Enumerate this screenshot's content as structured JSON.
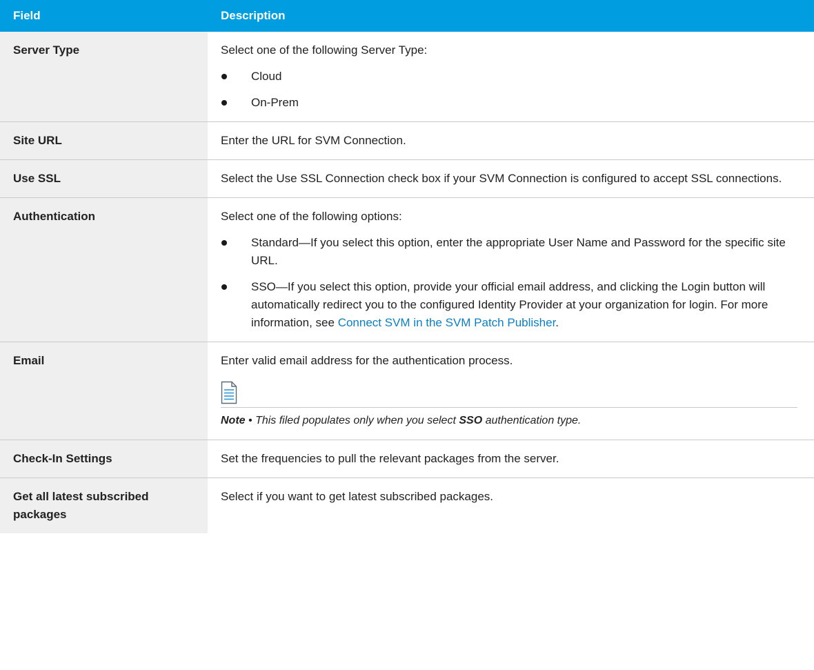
{
  "header": {
    "field": "Field",
    "description": "Description"
  },
  "rows": {
    "server_type": {
      "field": "Server Type",
      "intro": "Select one of the following Server Type:",
      "options": [
        "Cloud",
        "On-Prem"
      ]
    },
    "site_url": {
      "field": "Site URL",
      "text": "Enter the URL for SVM Connection."
    },
    "use_ssl": {
      "field": "Use SSL",
      "text": "Select the Use SSL Connection check box if your SVM Connection is configured to accept SSL connections."
    },
    "authentication": {
      "field": "Authentication",
      "intro": "Select one of the following options:",
      "standard": "Standard—If you select this option, enter the appropriate User Name and Password for the specific site URL.",
      "sso_text": "SSO—If you select this option, provide your official email address, and clicking the Login button will automatically redirect you to the configured Identity Provider at your organization for login. For more information, see ",
      "sso_link": "Connect SVM in the SVM Patch Publisher",
      "sso_end": "."
    },
    "email": {
      "field": "Email",
      "text": "Enter valid email address for the authentication process.",
      "note_label": "Note",
      "note_sep": " • ",
      "note_pre": "This filed populates only when you select ",
      "note_bold": "SSO",
      "note_post": " authentication type.",
      "icon": "document-note-icon"
    },
    "check_in": {
      "field": "Check-In Settings",
      "text": "Set the frequencies to pull the relevant packages from the server."
    },
    "latest": {
      "field": "Get all latest subscribed packages",
      "text": "Select if you want to get latest subscribed packages."
    }
  },
  "colors": {
    "header_bg": "#009ee0",
    "field_bg": "#efefef",
    "link": "#0a7fc4"
  }
}
